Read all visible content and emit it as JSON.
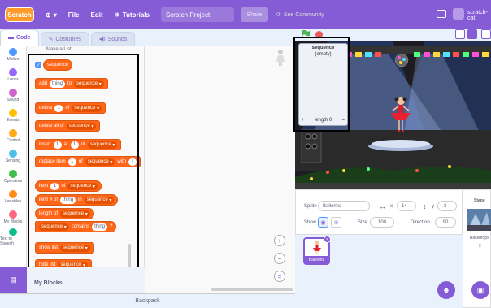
{
  "menubar": {
    "logo": "Scratch",
    "file": "File",
    "edit": "Edit",
    "tutorials": "Tutorials",
    "project_title": "Scratch Project",
    "share": "Share",
    "see_community": "See Community",
    "username": "scratch-cat"
  },
  "tabs": {
    "code": "Code",
    "costumes": "Costumes",
    "sounds": "Sounds"
  },
  "categories": [
    {
      "label": "Motion",
      "color": "#4c97ff"
    },
    {
      "label": "Looks",
      "color": "#9966ff"
    },
    {
      "label": "Sound",
      "color": "#cf63cf"
    },
    {
      "label": "Events",
      "color": "#ffbf00"
    },
    {
      "label": "Control",
      "color": "#ffab19"
    },
    {
      "label": "Sensing",
      "color": "#4cbfe6"
    },
    {
      "label": "Operators",
      "color": "#40bf4a"
    },
    {
      "label": "Variables",
      "color": "#ff8c1a"
    },
    {
      "label": "My Blocks",
      "color": "#ff6680"
    },
    {
      "label": "Text to Speech",
      "color": "#0fbd8c"
    }
  ],
  "palette": {
    "section_title": "Make a List",
    "list_reporter": "sequence",
    "add_block": {
      "a": "add",
      "slot": "thing",
      "b": "to",
      "list": "sequence"
    },
    "delete_block": {
      "a": "delete",
      "slot": "1",
      "b": "of",
      "list": "sequence"
    },
    "delete_all_block": {
      "a": "delete all of",
      "list": "sequence"
    },
    "insert_block": {
      "a": "insert",
      "slot1": "1",
      "b": "at",
      "slot2": "1",
      "c": "of",
      "list": "sequence"
    },
    "replace_block": {
      "a": "replace item",
      "slot1": "1",
      "b": "of",
      "list": "sequence",
      "c": "with",
      "slot2": "t"
    },
    "item_block": {
      "a": "item",
      "slot": "1",
      "b": "of",
      "list": "sequence"
    },
    "item_num_block": {
      "a": "item # of",
      "slot": "thing",
      "b": "in",
      "list": "sequence"
    },
    "length_block": {
      "a": "length of",
      "list": "sequence"
    },
    "contains_block": {
      "list": "sequence",
      "a": "contains",
      "slot": "thing",
      "q": "?"
    },
    "show_block": {
      "a": "show list",
      "list": "sequence"
    },
    "hide_block": {
      "a": "hide list",
      "list": "sequence"
    }
  },
  "myblocks": "My Blocks",
  "backpack": "Backpack",
  "zoom": {
    "in": "+",
    "out": "−",
    "reset": "="
  },
  "monitor": {
    "title": "sequence",
    "empty": "(empty)",
    "plus": "+",
    "length": "length 0",
    "eq": "="
  },
  "sprite_info": {
    "sprite_label": "Sprite",
    "sprite_name": "Ballerina",
    "x_label": "x",
    "x_value": "14",
    "y_label": "y",
    "y_value": "-3",
    "show_label": "Show",
    "size_label": "Size",
    "size_value": "100",
    "direction_label": "Direction",
    "direction_value": "90"
  },
  "sprites": [
    {
      "name": "Ballerina"
    }
  ],
  "stage_panel": {
    "title": "Stage",
    "backdrops_label": "Backdrops",
    "backdrops_count": "2"
  }
}
